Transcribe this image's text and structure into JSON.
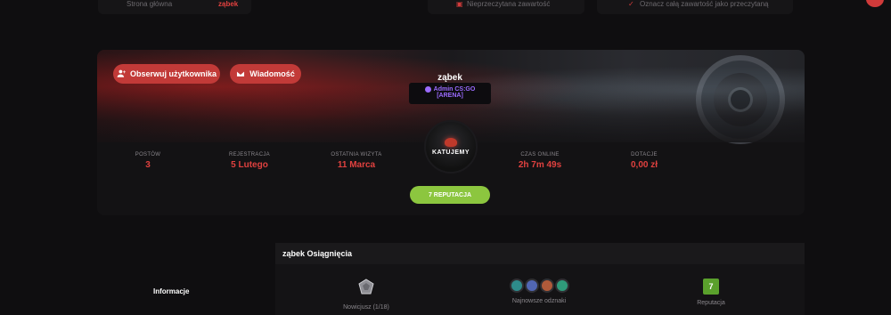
{
  "topbar": {
    "home": "Strona główna",
    "user": "ząbek",
    "unread": "Nieprzeczytana zawartość",
    "mark_read": "Oznacz całą zawartość jako przeczytaną"
  },
  "profile": {
    "follow_label": "Obserwuj użytkownika",
    "message_label": "Wiadomość",
    "username": "ząbek",
    "rank_line1": "Admin CS:GO",
    "rank_line2": "[ARENA]",
    "avatar_text": "KATUJEMY",
    "stats": [
      {
        "label": "POSTÓW",
        "value": "3"
      },
      {
        "label": "REJESTRACJA",
        "value": "5 Lutego"
      },
      {
        "label": "OSTATNIA WIZYTA",
        "value": "11 Marca"
      },
      {
        "label": "CZAS ONLINE",
        "value": "2h 7m 49s"
      },
      {
        "label": "DOTACJE",
        "value": "0,00 zł"
      }
    ],
    "reputation_label": "7 REPUTACJA"
  },
  "achievements": {
    "title": "ząbek Osiągnięcia",
    "info_label": "Informacje",
    "items": [
      {
        "label": "Nowicjusz (1/18)"
      },
      {
        "label": "Najnowsze odznaki"
      },
      {
        "label": "Reputacja",
        "value": "7"
      }
    ]
  },
  "colors": {
    "accent": "#c23a38",
    "stat_value": "#e0413f",
    "reputation": "#8cc63f",
    "rank": "#9b6bff"
  }
}
